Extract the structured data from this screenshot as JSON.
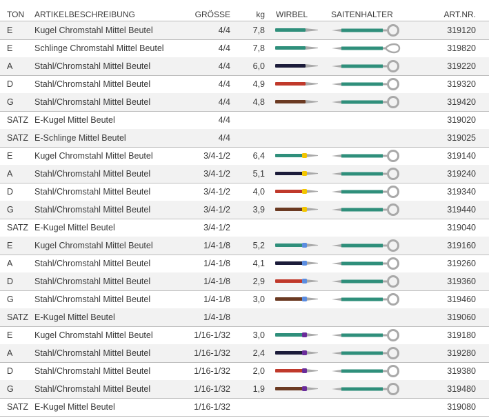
{
  "headers": {
    "ton": "TON",
    "desc": "ARTIKELBESCHREIBUNG",
    "size": "GRÖSSE",
    "kg": "kg",
    "wirbel": "WIRBEL",
    "halter": "SAITENHALTER",
    "art": "ART.NR."
  },
  "colors": {
    "teal": "#2f8f7b",
    "black": "#1c1c3a",
    "red": "#c0392b",
    "brown": "#6b3a22",
    "gray": "#a9a9a9",
    "yellow": "#f2c500",
    "blue": "#5b8de0",
    "purple": "#6a2c9a"
  },
  "rows": [
    {
      "ton": "E",
      "desc": "Kugel Chromstahl Mittel Beutel",
      "size": "4/4",
      "kg": "7,8",
      "art": "319120",
      "wirbel": "teal",
      "marker": "",
      "halter": "ring"
    },
    {
      "ton": "E",
      "desc": "Schlinge Chromstahl Mittel Beutel",
      "size": "4/4",
      "kg": "7,8",
      "art": "319820",
      "wirbel": "teal",
      "marker": "",
      "halter": "loop"
    },
    {
      "ton": "A",
      "desc": "Stahl/Chromstahl Mittel Beutel",
      "size": "4/4",
      "kg": "6,0",
      "art": "319220",
      "wirbel": "black",
      "marker": "",
      "halter": "ring"
    },
    {
      "ton": "D",
      "desc": "Stahl/Chromstahl Mittel Beutel",
      "size": "4/4",
      "kg": "4,9",
      "art": "319320",
      "wirbel": "red",
      "marker": "",
      "halter": "ring"
    },
    {
      "ton": "G",
      "desc": "Stahl/Chromstahl Mittel Beutel",
      "size": "4/4",
      "kg": "4,8",
      "art": "319420",
      "wirbel": "brown",
      "marker": "",
      "halter": "ring"
    },
    {
      "ton": "SATZ",
      "desc": "E-Kugel Mittel Beutel",
      "size": "4/4",
      "kg": "",
      "art": "319020",
      "wirbel": "",
      "marker": "",
      "halter": ""
    },
    {
      "ton": "SATZ",
      "desc": "E-Schlinge Mittel Beutel",
      "size": "4/4",
      "kg": "",
      "art": "319025",
      "wirbel": "",
      "marker": "",
      "halter": ""
    },
    {
      "ton": "E",
      "desc": "Kugel Chromstahl Mittel Beutel",
      "size": "3/4-1/2",
      "kg": "6,4",
      "art": "319140",
      "wirbel": "teal",
      "marker": "yellow",
      "halter": "ring"
    },
    {
      "ton": "A",
      "desc": "Stahl/Chromstahl Mittel Beutel",
      "size": "3/4-1/2",
      "kg": "5,1",
      "art": "319240",
      "wirbel": "black",
      "marker": "yellow",
      "halter": "ring"
    },
    {
      "ton": "D",
      "desc": "Stahl/Chromstahl Mittel Beutel",
      "size": "3/4-1/2",
      "kg": "4,0",
      "art": "319340",
      "wirbel": "red",
      "marker": "yellow",
      "halter": "ring"
    },
    {
      "ton": "G",
      "desc": "Stahl/Chromstahl Mittel Beutel",
      "size": "3/4-1/2",
      "kg": "3,9",
      "art": "319440",
      "wirbel": "brown",
      "marker": "yellow",
      "halter": "ring"
    },
    {
      "ton": "SATZ",
      "desc": "E-Kugel Mittel Beutel",
      "size": "3/4-1/2",
      "kg": "",
      "art": "319040",
      "wirbel": "",
      "marker": "",
      "halter": ""
    },
    {
      "ton": "E",
      "desc": "Kugel Chromstahl Mittel Beutel",
      "size": "1/4-1/8",
      "kg": "5,2",
      "art": "319160",
      "wirbel": "teal",
      "marker": "blue",
      "halter": "ring"
    },
    {
      "ton": "A",
      "desc": "Stahl/Chromstahl Mittel Beutel",
      "size": "1/4-1/8",
      "kg": "4,1",
      "art": "319260",
      "wirbel": "black",
      "marker": "blue",
      "halter": "ring"
    },
    {
      "ton": "D",
      "desc": "Stahl/Chromstahl Mittel Beutel",
      "size": "1/4-1/8",
      "kg": "2,9",
      "art": "319360",
      "wirbel": "red",
      "marker": "blue",
      "halter": "ring"
    },
    {
      "ton": "G",
      "desc": "Stahl/Chromstahl Mittel Beutel",
      "size": "1/4-1/8",
      "kg": "3,0",
      "art": "319460",
      "wirbel": "brown",
      "marker": "blue",
      "halter": "ring"
    },
    {
      "ton": "SATZ",
      "desc": "E-Kugel Mittel Beutel",
      "size": "1/4-1/8",
      "kg": "",
      "art": "319060",
      "wirbel": "",
      "marker": "",
      "halter": ""
    },
    {
      "ton": "E",
      "desc": "Kugel Chromstahl Mittel Beutel",
      "size": "1/16-1/32",
      "kg": "3,0",
      "art": "319180",
      "wirbel": "teal",
      "marker": "purple",
      "halter": "ring"
    },
    {
      "ton": "A",
      "desc": "Stahl/Chromstahl Mittel Beutel",
      "size": "1/16-1/32",
      "kg": "2,4",
      "art": "319280",
      "wirbel": "black",
      "marker": "purple",
      "halter": "ring"
    },
    {
      "ton": "D",
      "desc": "Stahl/Chromstahl Mittel Beutel",
      "size": "1/16-1/32",
      "kg": "2,0",
      "art": "319380",
      "wirbel": "red",
      "marker": "purple",
      "halter": "ring"
    },
    {
      "ton": "G",
      "desc": "Stahl/Chromstahl Mittel Beutel",
      "size": "1/16-1/32",
      "kg": "1,9",
      "art": "319480",
      "wirbel": "brown",
      "marker": "purple",
      "halter": "ring"
    },
    {
      "ton": "SATZ",
      "desc": "E-Kugel Mittel Beutel",
      "size": "1/16-1/32",
      "kg": "",
      "art": "319080",
      "wirbel": "",
      "marker": "",
      "halter": ""
    }
  ]
}
